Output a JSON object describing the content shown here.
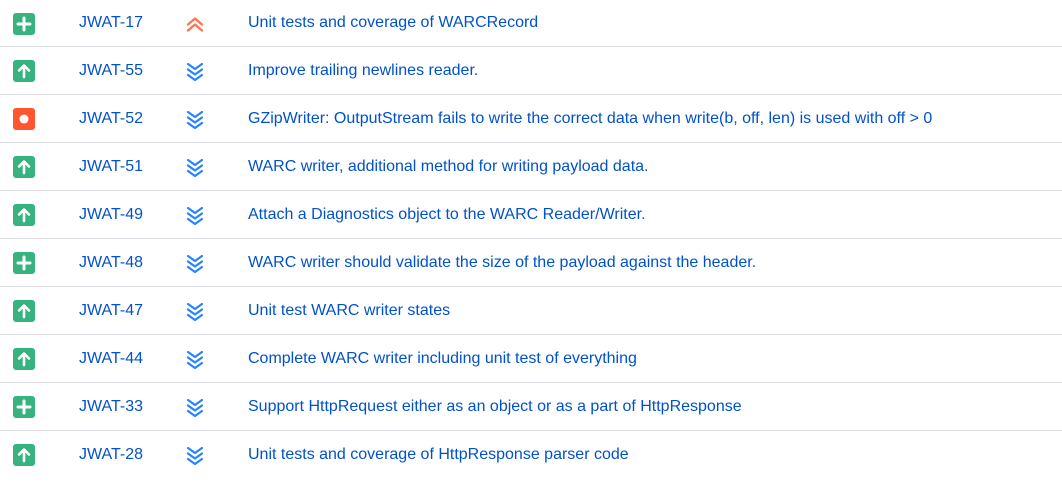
{
  "colors": {
    "link": "#0052cc",
    "new_feature": "#36b37e",
    "improvement": "#36b37e",
    "bug": "#ff5630",
    "priority_highest": "#ff7452",
    "priority_lowest": "#2684ff",
    "row_divider": "#dfe1e6"
  },
  "issues": [
    {
      "type": "new-feature",
      "type_icon": "plus-icon",
      "key": "JWAT-17",
      "priority": "highest",
      "priority_icon": "double-chevron-up-icon",
      "summary": "Unit tests and coverage of WARCRecord"
    },
    {
      "type": "improvement",
      "type_icon": "arrow-up-icon",
      "key": "JWAT-55",
      "priority": "lowest",
      "priority_icon": "triple-chevron-down-icon",
      "summary": "Improve trailing newlines reader."
    },
    {
      "type": "bug",
      "type_icon": "dot-icon",
      "key": "JWAT-52",
      "priority": "lowest",
      "priority_icon": "triple-chevron-down-icon",
      "summary": "GZipWriter: OutputStream fails to write the correct data when write(b, off, len) is used with off > 0"
    },
    {
      "type": "improvement",
      "type_icon": "arrow-up-icon",
      "key": "JWAT-51",
      "priority": "lowest",
      "priority_icon": "triple-chevron-down-icon",
      "summary": "WARC writer, additional method for writing payload data."
    },
    {
      "type": "improvement",
      "type_icon": "arrow-up-icon",
      "key": "JWAT-49",
      "priority": "lowest",
      "priority_icon": "triple-chevron-down-icon",
      "summary": "Attach a Diagnostics object to the WARC Reader/Writer."
    },
    {
      "type": "new-feature",
      "type_icon": "plus-icon",
      "key": "JWAT-48",
      "priority": "lowest",
      "priority_icon": "triple-chevron-down-icon",
      "summary": "WARC writer should validate the size of the payload against the header."
    },
    {
      "type": "improvement",
      "type_icon": "arrow-up-icon",
      "key": "JWAT-47",
      "priority": "lowest",
      "priority_icon": "triple-chevron-down-icon",
      "summary": "Unit test WARC writer states"
    },
    {
      "type": "improvement",
      "type_icon": "arrow-up-icon",
      "key": "JWAT-44",
      "priority": "lowest",
      "priority_icon": "triple-chevron-down-icon",
      "summary": "Complete WARC writer including unit test of everything"
    },
    {
      "type": "new-feature",
      "type_icon": "plus-icon",
      "key": "JWAT-33",
      "priority": "lowest",
      "priority_icon": "triple-chevron-down-icon",
      "summary": "Support HttpRequest either as an object or as a part of HttpResponse"
    },
    {
      "type": "improvement",
      "type_icon": "arrow-up-icon",
      "key": "JWAT-28",
      "priority": "lowest",
      "priority_icon": "triple-chevron-down-icon",
      "summary": "Unit tests and coverage of HttpResponse parser code"
    }
  ]
}
